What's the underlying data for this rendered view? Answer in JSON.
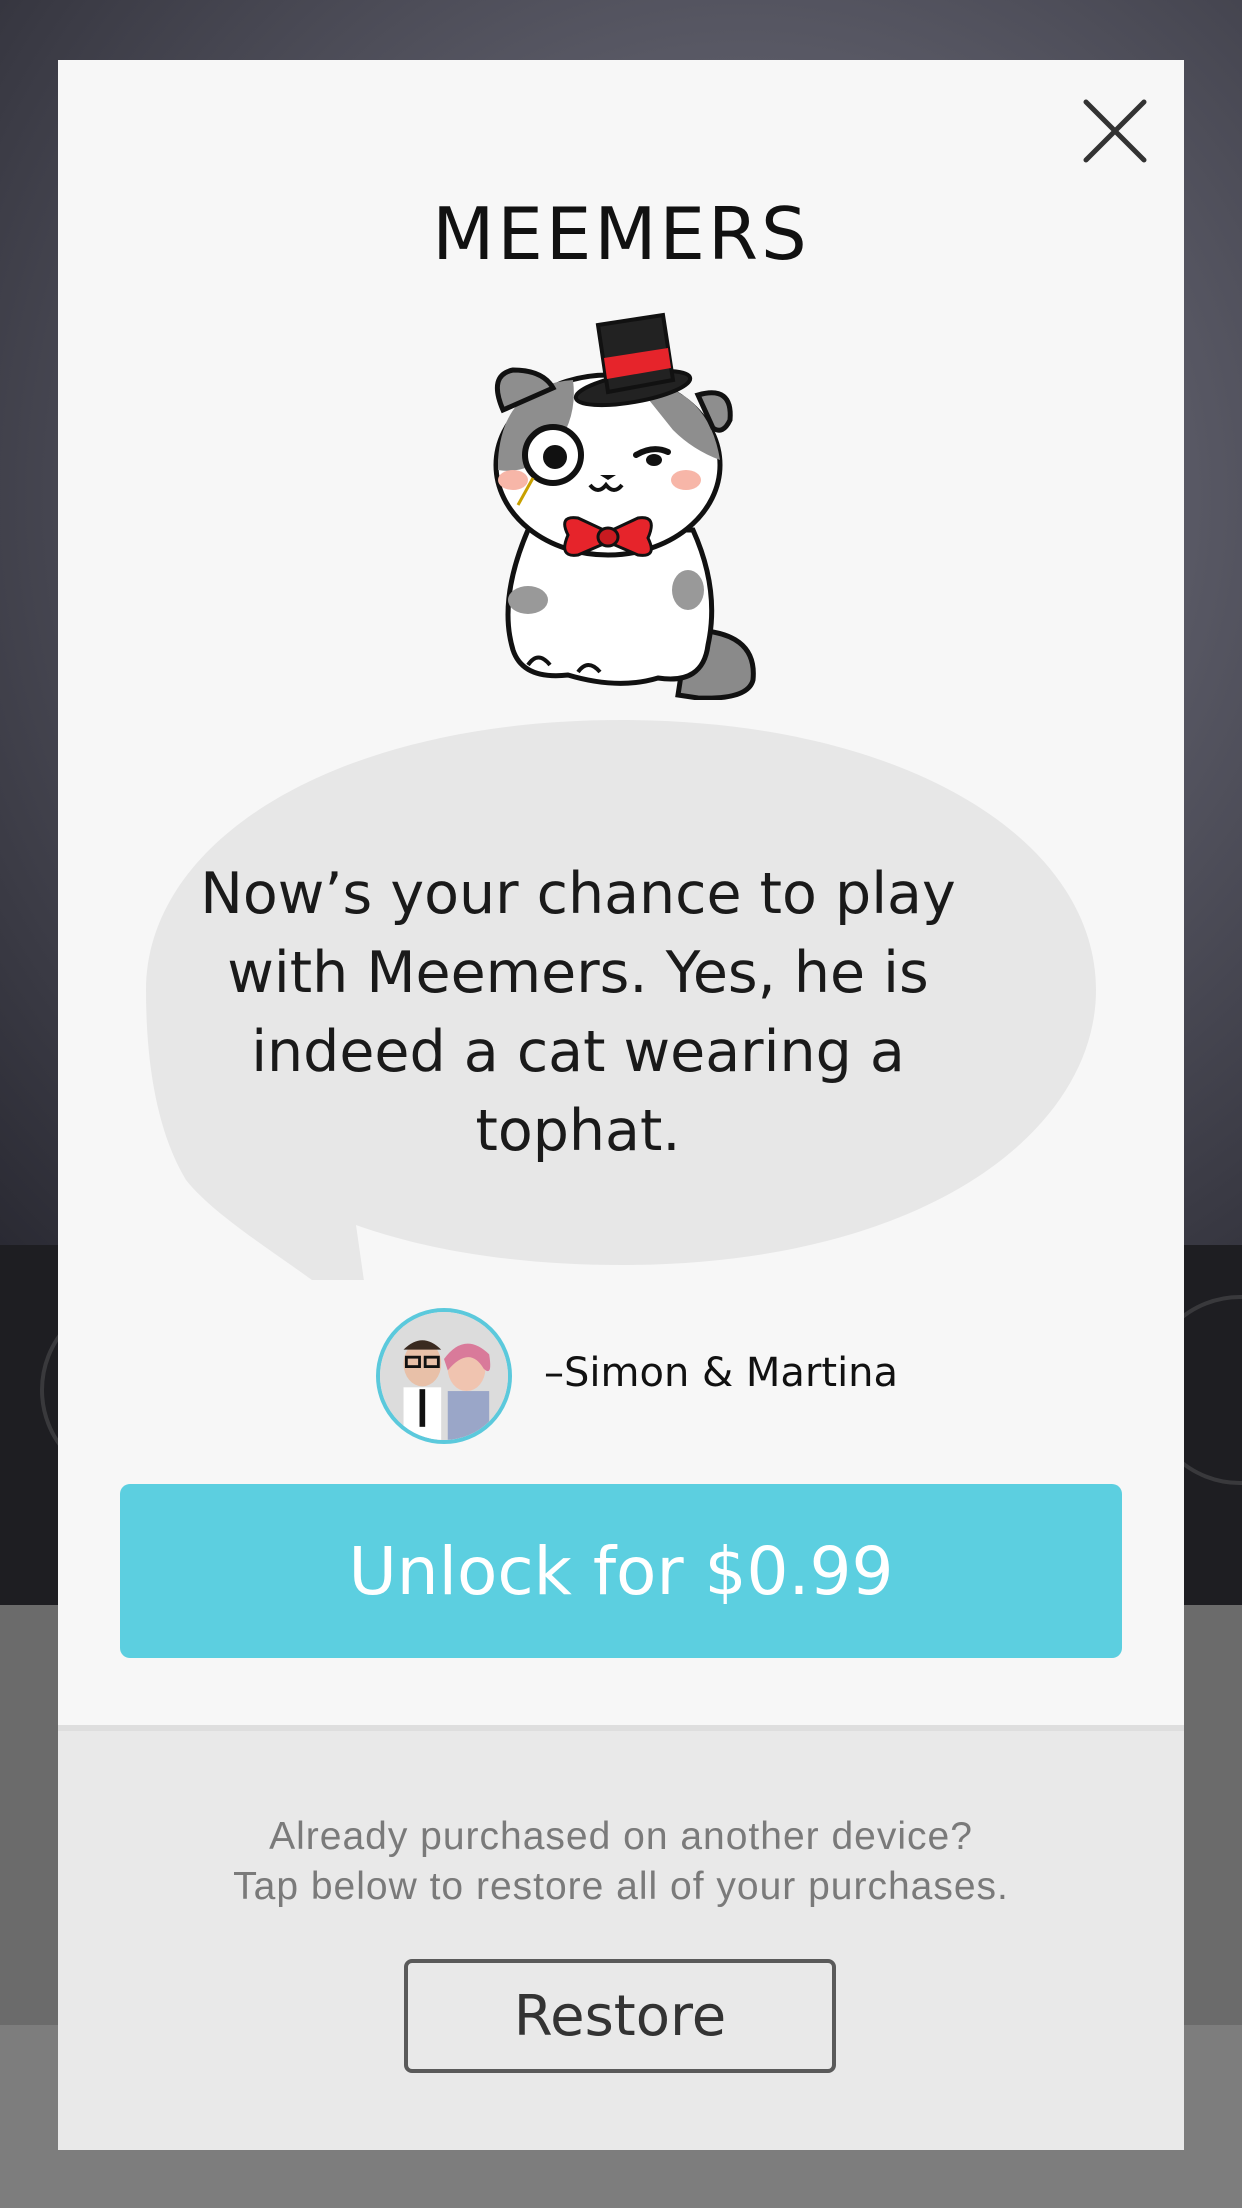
{
  "modal": {
    "title": "MEEMERS",
    "description": "Now’s your chance to play with Meemers. Yes, he is indeed a cat wearing a tophat.",
    "author": "–Simon & Martina",
    "unlock_label": "Unlock for $0.99",
    "restore_note_line1": "Already purchased on another device?",
    "restore_note_line2": "Tap below to restore all of your purchases.",
    "restore_label": "Restore",
    "close_icon": "close-icon",
    "accent_color": "#5ccfe0"
  }
}
